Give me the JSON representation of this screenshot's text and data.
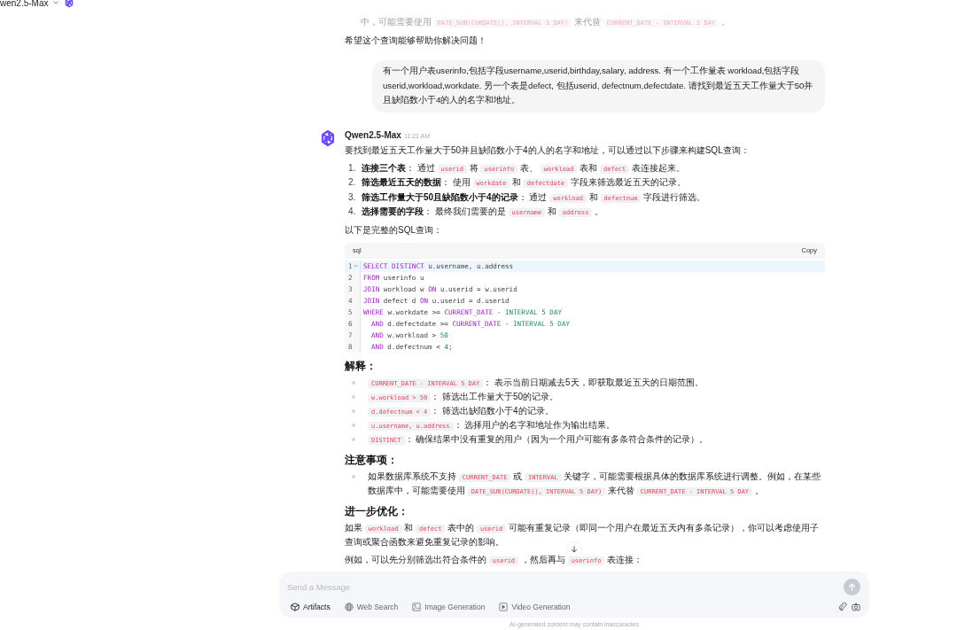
{
  "model_selector": {
    "label": "wen2.5-Max"
  },
  "earlier_message": {
    "faded_paragraph": [
      {
        "kind": "text",
        "text": "中，可能需要使用 "
      },
      {
        "kind": "code",
        "text": "DATE_SUB(CURDATE(), INTERVAL 5 DAY)"
      },
      {
        "kind": "text",
        "text": " 来代替 "
      },
      {
        "kind": "code",
        "text": "CURRENT_DATE - INTERVAL 5 DAY"
      },
      {
        "kind": "text",
        "text": " 。"
      }
    ],
    "closing": "希望这个查询能够帮助你解决问题！"
  },
  "user_message": {
    "text": "有一个用户表userinfo,包括字段username,userid,birthday,salary, address. 有一个工作量表 workload,包括字段userid,workload,workdate. 另一个表是defect, 包括userid, defectnum,defectdate. 请找到最近五天工作量大于50并且缺陷数小于4的人的名字和地址。"
  },
  "reply": {
    "author": "Qwen2.5-Max",
    "time": "11:21 AM",
    "blocks": [
      {
        "kind": "paragraph",
        "segments": [
          {
            "kind": "text",
            "text": "要找到最近五天工作量大于50并且缺陷数小于4的人的名字和地址，可以通过以下步骤来构建SQL查询："
          }
        ]
      },
      {
        "kind": "ordered_list",
        "items": [
          {
            "number": "1.",
            "segments": [
              {
                "kind": "strong",
                "text": "连接三个表"
              },
              {
                "kind": "text",
                "text": "： 通过 "
              },
              {
                "kind": "code",
                "text": "userid"
              },
              {
                "kind": "text",
                "text": " 将 "
              },
              {
                "kind": "code",
                "text": "userinfo"
              },
              {
                "kind": "text",
                "text": " 表、 "
              },
              {
                "kind": "code",
                "text": "workload"
              },
              {
                "kind": "text",
                "text": " 表和 "
              },
              {
                "kind": "code",
                "text": "defect"
              },
              {
                "kind": "text",
                "text": " 表连接起来。"
              }
            ]
          },
          {
            "number": "2.",
            "segments": [
              {
                "kind": "strong",
                "text": "筛选最近五天的数据"
              },
              {
                "kind": "text",
                "text": "： 使用 "
              },
              {
                "kind": "code",
                "text": "workdate"
              },
              {
                "kind": "text",
                "text": " 和 "
              },
              {
                "kind": "code",
                "text": "defectdate"
              },
              {
                "kind": "text",
                "text": " 字段来筛选最近五天的记录。"
              }
            ]
          },
          {
            "number": "3.",
            "segments": [
              {
                "kind": "strong",
                "text": "筛选工作量大于50且缺陷数小于4的记录"
              },
              {
                "kind": "text",
                "text": "： 通过 "
              },
              {
                "kind": "code",
                "text": "workload"
              },
              {
                "kind": "text",
                "text": " 和 "
              },
              {
                "kind": "code",
                "text": "defectnum"
              },
              {
                "kind": "text",
                "text": " 字段进行筛选。"
              }
            ]
          },
          {
            "number": "4.",
            "segments": [
              {
                "kind": "strong",
                "text": "选择需要的字段"
              },
              {
                "kind": "text",
                "text": "： 最终我们需要的是 "
              },
              {
                "kind": "code",
                "text": "username"
              },
              {
                "kind": "text",
                "text": " 和 "
              },
              {
                "kind": "code",
                "text": "address"
              },
              {
                "kind": "text",
                "text": " 。"
              }
            ]
          }
        ]
      },
      {
        "kind": "paragraph",
        "segments": [
          {
            "kind": "text",
            "text": "以下是完整的SQL查询："
          }
        ]
      },
      {
        "kind": "code",
        "language": "sql",
        "copy_label": "Copy",
        "lines": [
          {
            "number": "1",
            "highlighted": true,
            "tokens": [
              {
                "kind": "keyword",
                "text": "SELECT DISTINCT"
              },
              {
                "kind": "plain",
                "text": " u.username, u.address"
              }
            ]
          },
          {
            "number": "2",
            "highlighted": false,
            "tokens": [
              {
                "kind": "keyword",
                "text": "FROM"
              },
              {
                "kind": "plain",
                "text": " userinfo u"
              }
            ]
          },
          {
            "number": "3",
            "highlighted": false,
            "tokens": [
              {
                "kind": "keyword",
                "text": "JOIN"
              },
              {
                "kind": "plain",
                "text": " workload w "
              },
              {
                "kind": "keyword",
                "text": "ON"
              },
              {
                "kind": "plain",
                "text": " u.userid = w.userid"
              }
            ]
          },
          {
            "number": "4",
            "highlighted": false,
            "tokens": [
              {
                "kind": "keyword",
                "text": "JOIN"
              },
              {
                "kind": "plain",
                "text": " defect d "
              },
              {
                "kind": "keyword",
                "text": "ON"
              },
              {
                "kind": "plain",
                "text": " u.userid = d.userid"
              }
            ]
          },
          {
            "number": "5",
            "highlighted": false,
            "tokens": [
              {
                "kind": "keyword",
                "text": "WHERE"
              },
              {
                "kind": "plain",
                "text": " w.workdate >= "
              },
              {
                "kind": "keyword",
                "text": "CURRENT_DATE"
              },
              {
                "kind": "plain",
                "text": " - "
              },
              {
                "kind": "literal",
                "text": "INTERVAL 5 DAY"
              }
            ]
          },
          {
            "number": "6",
            "highlighted": false,
            "indented": true,
            "tokens": [
              {
                "kind": "keyword",
                "text": "AND"
              },
              {
                "kind": "plain",
                "text": " d.defectdate >= "
              },
              {
                "kind": "keyword",
                "text": "CURRENT_DATE"
              },
              {
                "kind": "plain",
                "text": " - "
              },
              {
                "kind": "literal",
                "text": "INTERVAL 5 DAY"
              }
            ]
          },
          {
            "number": "7",
            "highlighted": false,
            "indented": true,
            "tokens": [
              {
                "kind": "keyword",
                "text": "AND"
              },
              {
                "kind": "plain",
                "text": " w.workload > "
              },
              {
                "kind": "literal",
                "text": "50"
              }
            ]
          },
          {
            "number": "8",
            "highlighted": false,
            "indented": true,
            "tokens": [
              {
                "kind": "keyword",
                "text": "AND"
              },
              {
                "kind": "plain",
                "text": " d.defectnum < "
              },
              {
                "kind": "literal",
                "text": "4"
              },
              {
                "kind": "plain",
                "text": ";"
              }
            ]
          }
        ]
      },
      {
        "kind": "heading",
        "text": "解释："
      },
      {
        "kind": "bullet_list",
        "items": [
          {
            "segments": [
              {
                "kind": "code",
                "text": "CURRENT_DATE - INTERVAL 5 DAY"
              },
              {
                "kind": "text",
                "text": "： 表示当前日期减去5天，即获取最近五天的日期范围。"
              }
            ]
          },
          {
            "segments": [
              {
                "kind": "code",
                "text": "w.workload > 50"
              },
              {
                "kind": "text",
                "text": "： 筛选出工作量大于50的记录。"
              }
            ]
          },
          {
            "segments": [
              {
                "kind": "code",
                "text": "d.defectnum < 4"
              },
              {
                "kind": "text",
                "text": "： 筛选出缺陷数小于4的记录。"
              }
            ]
          },
          {
            "segments": [
              {
                "kind": "code",
                "text": "u.username, u.address"
              },
              {
                "kind": "text",
                "text": "： 选择用户的名字和地址作为输出结果。"
              }
            ]
          },
          {
            "segments": [
              {
                "kind": "code",
                "text": "DISTINCT"
              },
              {
                "kind": "text",
                "text": "： 确保结果中没有重复的用户（因为一个用户可能有多条符合条件的记录）。"
              }
            ]
          }
        ]
      },
      {
        "kind": "heading",
        "text": "注意事项："
      },
      {
        "kind": "bullet_list",
        "items": [
          {
            "segments": [
              {
                "kind": "text",
                "text": "如果数据库系统不支持 "
              },
              {
                "kind": "code",
                "text": "CURRENT_DATE"
              },
              {
                "kind": "text",
                "text": " 或 "
              },
              {
                "kind": "code",
                "text": "INTERVAL"
              },
              {
                "kind": "text",
                "text": " 关键字，可能需要根据具体的数据库系统进行调整。例如，在某些数据库中，可能需要使用 "
              },
              {
                "kind": "code",
                "text": "DATE_SUB(CURDATE(), INTERVAL 5 DAY)"
              },
              {
                "kind": "text",
                "text": " 来代替 "
              },
              {
                "kind": "code",
                "text": "CURRENT_DATE - INTERVAL 5 DAY"
              },
              {
                "kind": "text",
                "text": " 。"
              }
            ]
          }
        ]
      },
      {
        "kind": "heading",
        "text": "进一步优化："
      },
      {
        "kind": "paragraph",
        "segments": [
          {
            "kind": "text",
            "text": "如果 "
          },
          {
            "kind": "code",
            "text": "workload"
          },
          {
            "kind": "text",
            "text": " 和 "
          },
          {
            "kind": "code",
            "text": "defect"
          },
          {
            "kind": "text",
            "text": " 表中的 "
          },
          {
            "kind": "code",
            "text": "userid"
          },
          {
            "kind": "text",
            "text": " 可能有重复记录（即同一个用户在最近五天内有多条记录），你可以考虑使用子查询或聚合函数来避免重复记录的影响。"
          }
        ]
      },
      {
        "kind": "paragraph",
        "segments": [
          {
            "kind": "text",
            "text": "例如，可以先分别筛选出符合条件的 "
          },
          {
            "kind": "code",
            "text": "userid"
          },
          {
            "kind": "text",
            "text": " ，然后再与 "
          },
          {
            "kind": "code",
            "text": "userinfo"
          },
          {
            "kind": "text",
            "text": " 表连接："
          }
        ]
      }
    ]
  },
  "composer": {
    "placeholder": "Send a Message",
    "tools": [
      {
        "kind": "cube",
        "label": "Artifacts",
        "selected": true
      },
      {
        "kind": "globe",
        "label": "Web Search",
        "selected": false
      },
      {
        "kind": "image",
        "label": "Image Generation",
        "selected": false
      },
      {
        "kind": "video",
        "label": "Video Generation",
        "selected": false
      }
    ],
    "footer": "AI-generated content may contain inaccuracies"
  }
}
